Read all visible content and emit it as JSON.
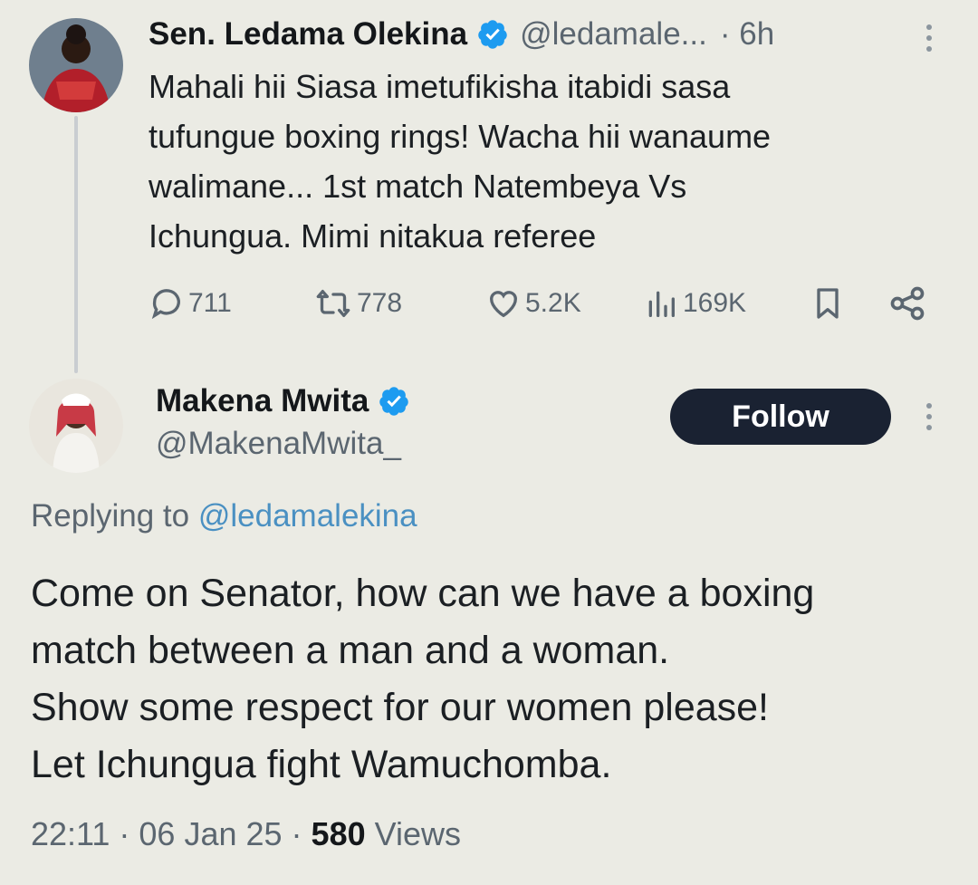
{
  "parent_tweet": {
    "author_name": "Sen. Ledama Olekina",
    "handle": "@ledamale...",
    "time": "· 6h",
    "text_lines": [
      "Mahali  hii Siasa imetufikisha itabidi sasa",
      "tufungue boxing rings! Wacha hii wanaume",
      "walimane... 1st match Natembeya Vs",
      "Ichungua. Mimi nitakua referee"
    ],
    "replies": "711",
    "reposts": "778",
    "likes": "5.2K",
    "views": "169K"
  },
  "reply_tweet": {
    "author_name": "Makena Mwita",
    "handle": "@MakenaMwita_",
    "follow_label": "Follow",
    "replying_prefix": "Replying to",
    "replying_to": "@ledamalekina",
    "text_lines": [
      "Come on Senator, how can we have a boxing",
      "match between a man and a woman.",
      "Show some respect for our women please!",
      "Let Ichungua fight Wamuchomba."
    ],
    "timestamp": "22:11 · 06 Jan 25 ·",
    "views_count": "580",
    "views_label": "Views"
  },
  "colors": {
    "background": "#ebebe4",
    "verified": "#1d9bf0",
    "link": "#4a90c2",
    "follow_button": "#1a2232"
  },
  "icons": [
    "verified-badge-icon",
    "more-icon",
    "reply-icon",
    "repost-icon",
    "like-icon",
    "views-icon",
    "bookmark-icon",
    "share-icon"
  ]
}
